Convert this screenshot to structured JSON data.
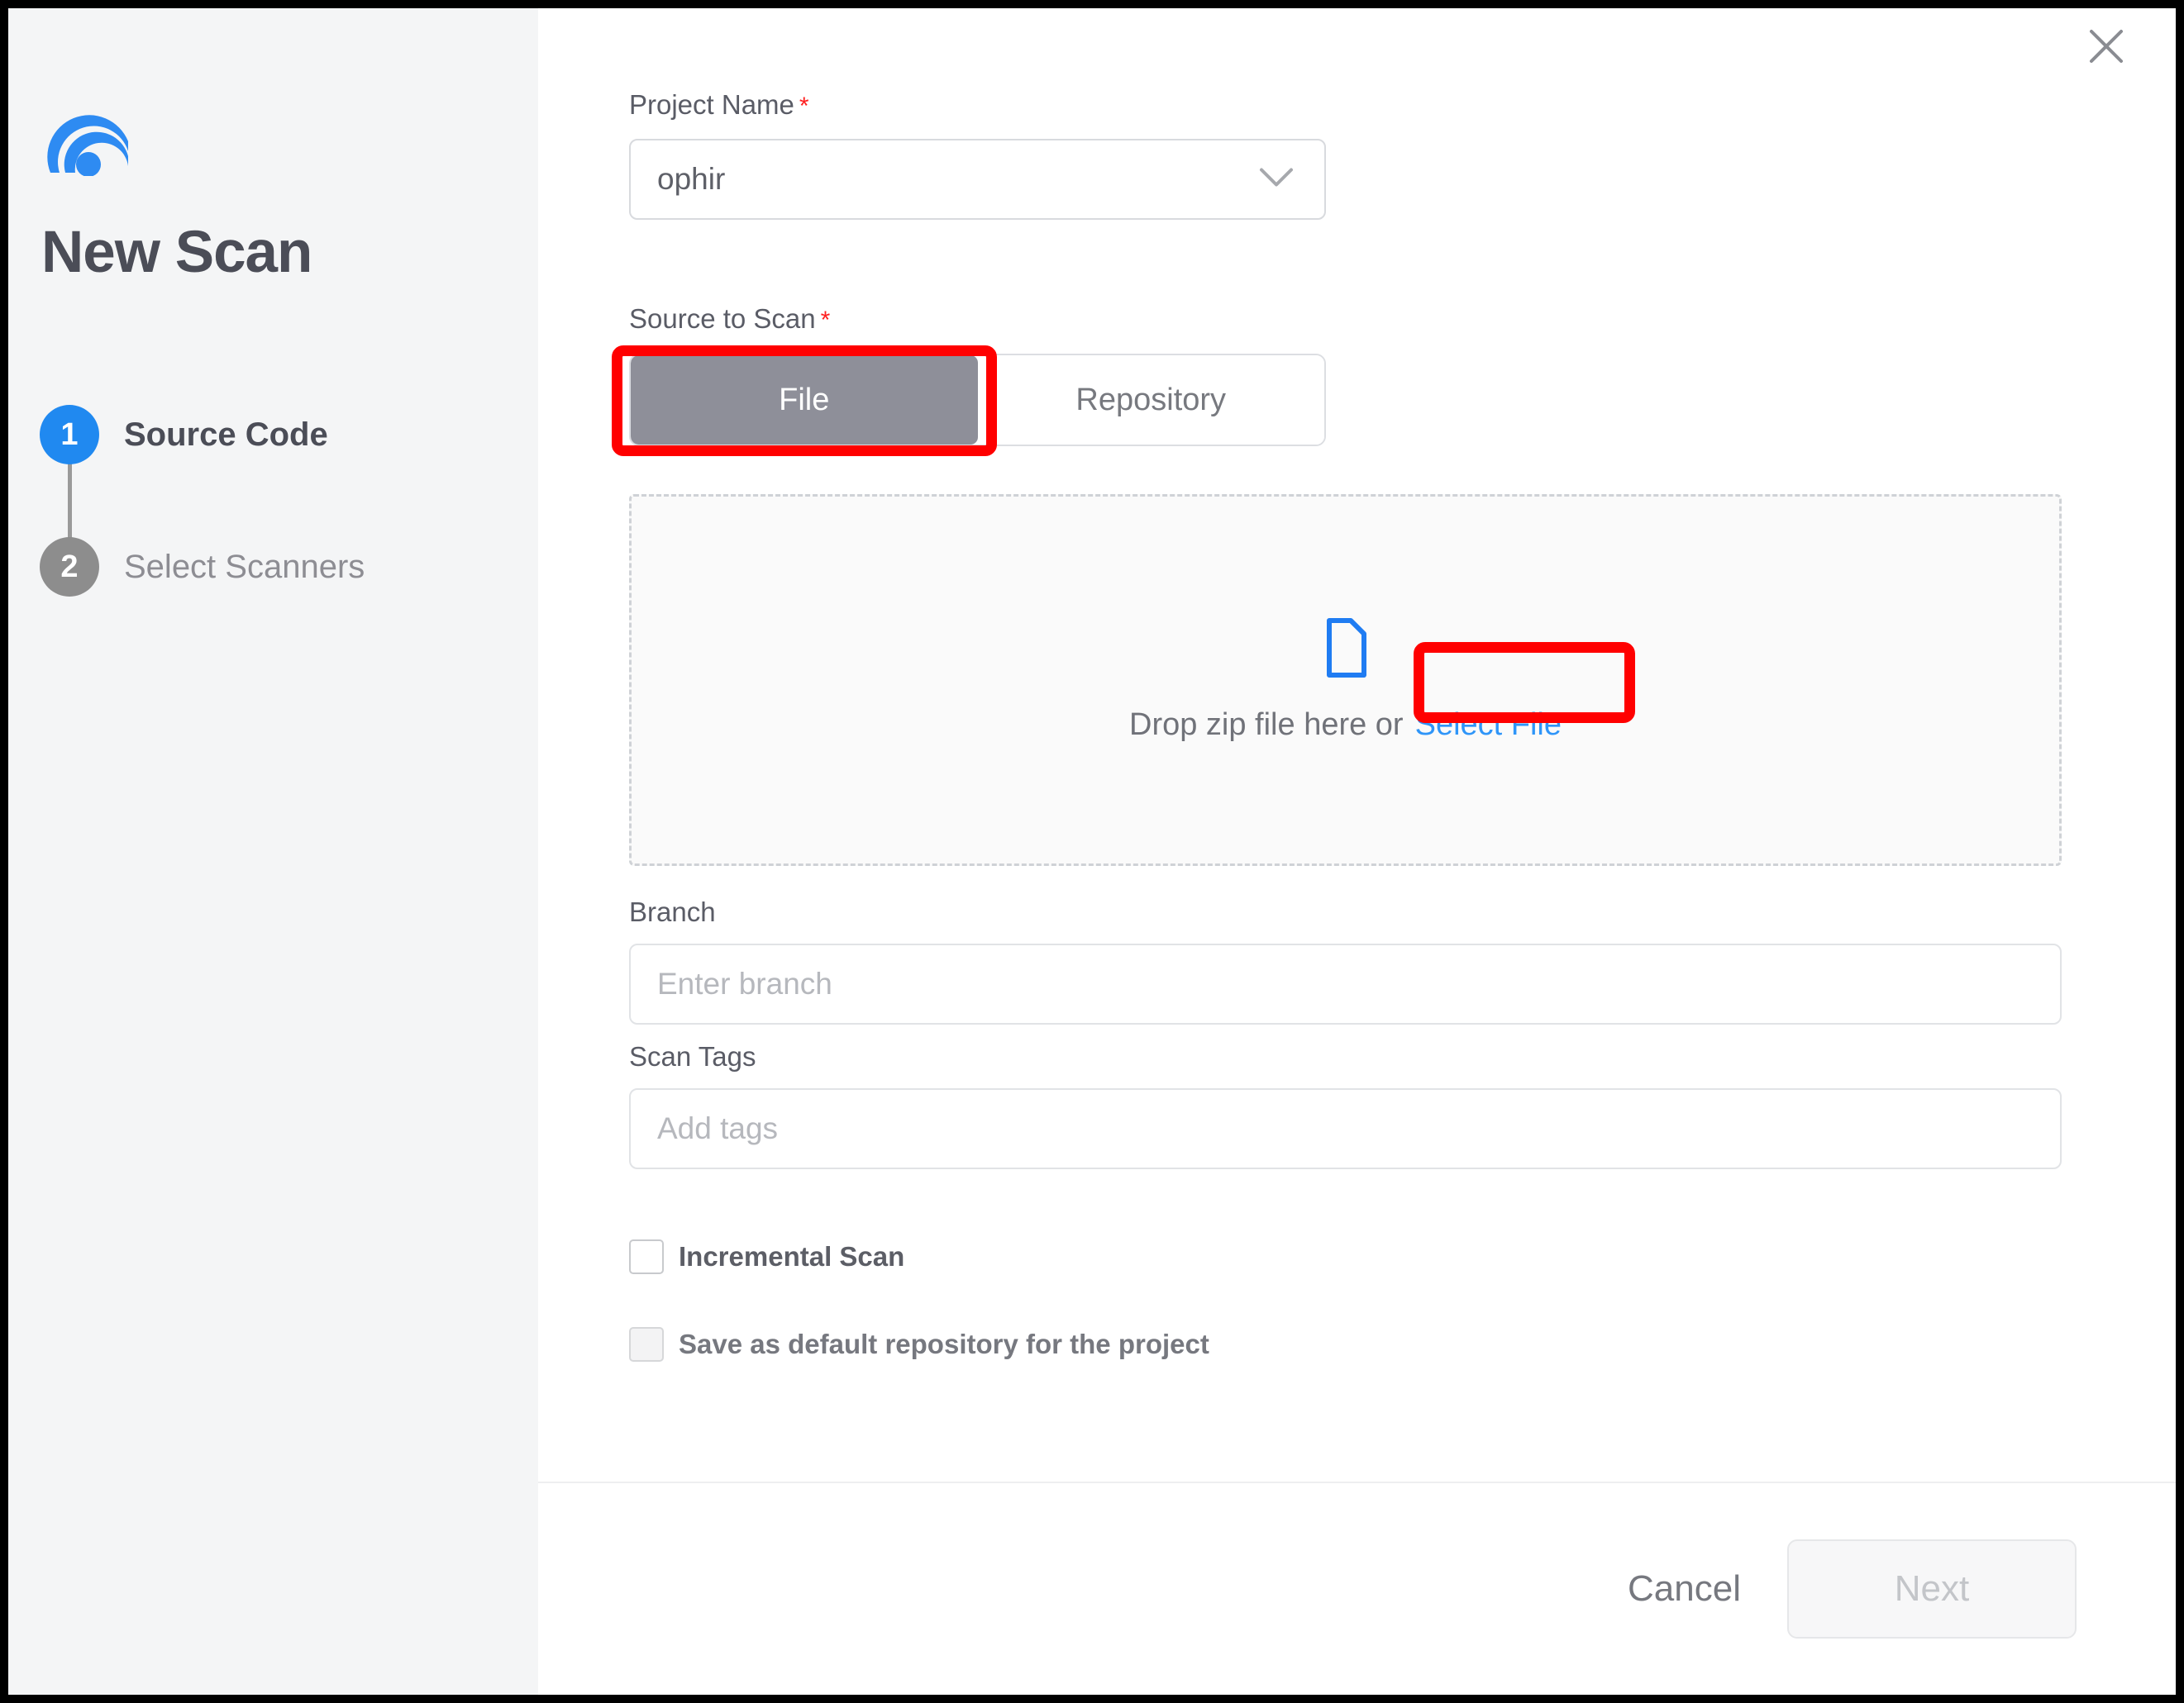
{
  "sidebar": {
    "logo_icon": "radar-spiral-logo-icon",
    "title": "New Scan",
    "steps": [
      {
        "number": "1",
        "label": "Source Code",
        "state": "active"
      },
      {
        "number": "2",
        "label": "Select Scanners",
        "state": "inactive"
      }
    ]
  },
  "dialog": {
    "close_icon": "close-icon"
  },
  "form": {
    "project_name": {
      "label": "Project Name",
      "required_mark": "*",
      "value": "ophir",
      "chevron_icon": "chevron-down-icon"
    },
    "source_to_scan": {
      "label": "Source to Scan",
      "required_mark": "*",
      "options": [
        "File",
        "Repository"
      ],
      "selected": "File"
    },
    "dropzone": {
      "file_icon": "file-document-icon",
      "hint_text": "Drop zip file here or",
      "link_text": "Select File"
    },
    "branch": {
      "label": "Branch",
      "placeholder": "Enter branch",
      "value": ""
    },
    "scan_tags": {
      "label": "Scan Tags",
      "placeholder": "Add tags",
      "value": ""
    },
    "checkboxes": [
      {
        "label": "Incremental Scan",
        "checked": false,
        "disabled": false
      },
      {
        "label": "Save as default repository for the project",
        "checked": false,
        "disabled": true
      }
    ]
  },
  "footer": {
    "cancel_label": "Cancel",
    "next_label": "Next",
    "next_disabled": true
  },
  "annotations": [
    {
      "name": "file-toggle-highlight",
      "target": "File"
    },
    {
      "name": "select-file-highlight",
      "target": "Select File"
    }
  ],
  "colors": {
    "accent_blue": "#2089f0",
    "link_blue": "#2f95f8",
    "annotation_red": "#ff0000",
    "required_red": "#ff1f1f",
    "toggle_active_gray": "#8e8f99",
    "sidebar_bg": "#f4f5f6",
    "step_inactive_gray": "#8d8d8d"
  }
}
